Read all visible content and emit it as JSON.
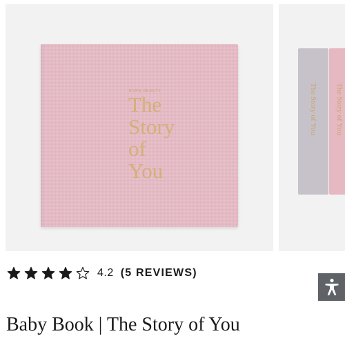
{
  "gallery": {
    "main_image": {
      "brand_text": "BORN BEAUTY",
      "title_lines": [
        "The",
        "Story",
        "of",
        "You"
      ]
    },
    "next_image": {
      "spines": [
        {
          "label": "The Story of You",
          "color": "#c7c2c9"
        },
        {
          "label": "The Story of You",
          "color": "#e6b8c2"
        }
      ]
    }
  },
  "rating": {
    "stars_total": 5,
    "stars_filled": 4,
    "value": "4.2",
    "reviews_label": "(5 REVIEWS)"
  },
  "accessibility": {
    "icon": "accessibility-person-icon"
  },
  "product": {
    "title": "Baby Book | The Story of You"
  },
  "colors": {
    "cover_pink": "#e8bcc7",
    "gold_foil": "#d4b078",
    "text_dark": "#1a1a1a",
    "a11y_bg": "#5f6368"
  }
}
